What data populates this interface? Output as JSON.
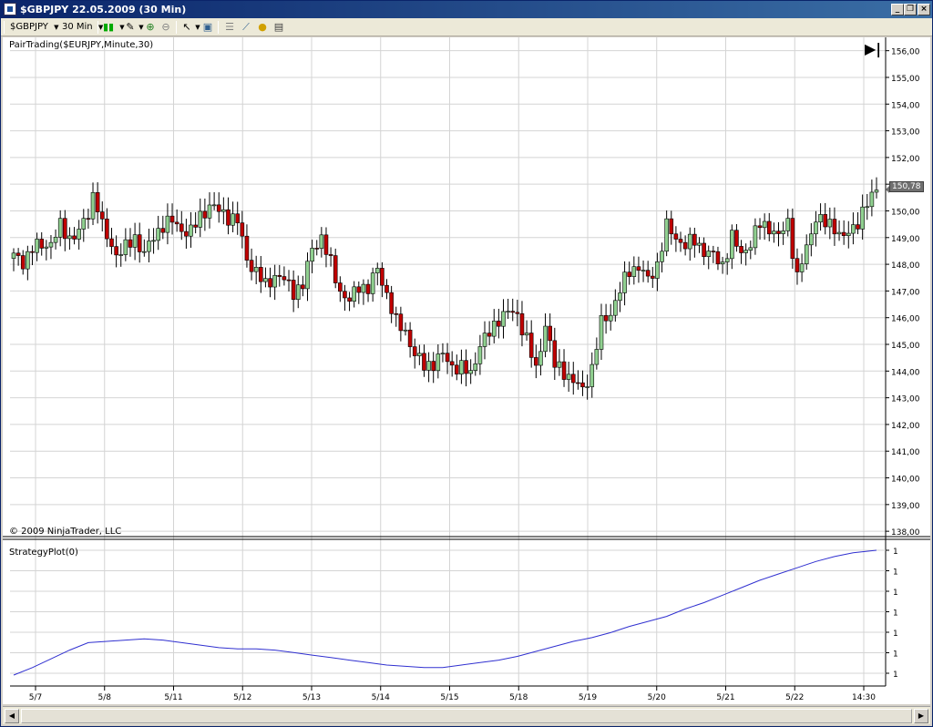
{
  "window": {
    "title": "$GBPJPY  22.05.2009 (30 Min)"
  },
  "toolbar": {
    "instrument": "$GBPJPY",
    "interval": "30 Min"
  },
  "chart": {
    "price_panel_label": "PairTrading($EURJPY,Minute,30)",
    "copyright": "© 2009 NinjaTrader, LLC",
    "strategy_panel_label": "StrategyPlot(0)",
    "last_price_label": "150,78",
    "colors": {
      "up": "#90d090",
      "down": "#c00000",
      "strategy_line": "#3030d0",
      "grid": "#d4d4d4"
    }
  },
  "chart_data": [
    {
      "type": "candlestick",
      "title": "PairTrading($EURJPY,Minute,30)",
      "ylim": [
        137.8,
        156.5
      ],
      "y_ticks": [
        "138,00",
        "139,00",
        "140,00",
        "141,00",
        "142,00",
        "143,00",
        "144,00",
        "145,00",
        "146,00",
        "147,00",
        "148,00",
        "149,00",
        "150,00",
        "151,00",
        "152,00",
        "153,00",
        "154,00",
        "155,00",
        "156,00"
      ],
      "x_ticks": [
        "5/7",
        "5/8",
        "5/11",
        "5/12",
        "5/13",
        "5/14",
        "5/15",
        "5/18",
        "5/19",
        "5/20",
        "5/21",
        "5/22",
        "14:30"
      ],
      "path": [
        [
          0,
          148.3
        ],
        [
          2,
          148.1
        ],
        [
          4,
          148.6
        ],
        [
          6,
          148.7
        ],
        [
          8,
          148.8
        ],
        [
          10,
          149.4
        ],
        [
          12,
          149.0
        ],
        [
          14,
          149.2
        ],
        [
          16,
          149.9
        ],
        [
          17,
          150.6
        ],
        [
          18,
          150.2
        ],
        [
          19,
          149.4
        ],
        [
          20,
          149.0
        ],
        [
          22,
          148.4
        ],
        [
          24,
          148.6
        ],
        [
          26,
          149.0
        ],
        [
          28,
          148.4
        ],
        [
          30,
          149.0
        ],
        [
          32,
          149.5
        ],
        [
          34,
          149.6
        ],
        [
          36,
          149.3
        ],
        [
          38,
          149.2
        ],
        [
          40,
          149.8
        ],
        [
          42,
          150.2
        ],
        [
          44,
          150.0
        ],
        [
          46,
          149.8
        ],
        [
          48,
          149.6
        ],
        [
          50,
          148.2
        ],
        [
          52,
          147.7
        ],
        [
          54,
          147.2
        ],
        [
          56,
          147.6
        ],
        [
          58,
          147.4
        ],
        [
          60,
          147.0
        ],
        [
          62,
          147.2
        ],
        [
          64,
          148.6
        ],
        [
          66,
          149.0
        ],
        [
          68,
          148.0
        ],
        [
          70,
          147.0
        ],
        [
          72,
          146.6
        ],
        [
          74,
          147.2
        ],
        [
          76,
          147.1
        ],
        [
          78,
          147.8
        ],
        [
          80,
          146.9
        ],
        [
          82,
          145.8
        ],
        [
          84,
          145.5
        ],
        [
          86,
          144.6
        ],
        [
          88,
          144.2
        ],
        [
          90,
          144.3
        ],
        [
          92,
          144.6
        ],
        [
          94,
          144.2
        ],
        [
          96,
          144.1
        ],
        [
          98,
          143.9
        ],
        [
          100,
          145.0
        ],
        [
          102,
          145.4
        ],
        [
          104,
          146.0
        ],
        [
          106,
          146.2
        ],
        [
          108,
          146.1
        ],
        [
          110,
          145.2
        ],
        [
          112,
          144.0
        ],
        [
          114,
          145.8
        ],
        [
          116,
          144.2
        ],
        [
          118,
          144.0
        ],
        [
          120,
          143.6
        ],
        [
          122,
          143.3
        ],
        [
          124,
          144.1
        ],
        [
          126,
          145.8
        ],
        [
          128,
          146.2
        ],
        [
          130,
          147.0
        ],
        [
          132,
          147.8
        ],
        [
          134,
          147.9
        ],
        [
          136,
          147.4
        ],
        [
          138,
          148.0
        ],
        [
          140,
          149.4
        ],
        [
          142,
          149.0
        ],
        [
          144,
          148.7
        ],
        [
          146,
          148.9
        ],
        [
          148,
          148.5
        ],
        [
          150,
          148.3
        ],
        [
          152,
          148.0
        ],
        [
          154,
          149.0
        ],
        [
          156,
          148.4
        ],
        [
          158,
          148.8
        ],
        [
          160,
          149.5
        ],
        [
          162,
          149.4
        ],
        [
          164,
          149.0
        ],
        [
          166,
          149.6
        ],
        [
          168,
          147.5
        ],
        [
          170,
          148.6
        ],
        [
          172,
          149.8
        ],
        [
          174,
          149.5
        ],
        [
          176,
          149.4
        ],
        [
          178,
          149.0
        ],
        [
          180,
          149.3
        ],
        [
          182,
          150.0
        ],
        [
          184,
          150.5
        ],
        [
          185,
          150.8
        ]
      ]
    },
    {
      "type": "line",
      "title": "StrategyPlot(0)",
      "y_tick_labels": [
        "1",
        "1",
        "1",
        "1",
        "1",
        "1",
        "1"
      ],
      "x": [
        0,
        4,
        8,
        12,
        16,
        20,
        24,
        28,
        32,
        36,
        40,
        44,
        48,
        52,
        56,
        60,
        64,
        68,
        72,
        76,
        80,
        84,
        88,
        92,
        96,
        100,
        104,
        108,
        112,
        116,
        120,
        124,
        128,
        132,
        136,
        140,
        144,
        148,
        152,
        156,
        160,
        164,
        168,
        172,
        176,
        180,
        185
      ],
      "values": [
        0.02,
        0.08,
        0.15,
        0.22,
        0.28,
        0.29,
        0.3,
        0.31,
        0.3,
        0.28,
        0.26,
        0.24,
        0.23,
        0.23,
        0.22,
        0.2,
        0.18,
        0.16,
        0.14,
        0.12,
        0.1,
        0.09,
        0.08,
        0.08,
        0.1,
        0.12,
        0.14,
        0.17,
        0.21,
        0.25,
        0.29,
        0.32,
        0.36,
        0.41,
        0.45,
        0.49,
        0.55,
        0.6,
        0.66,
        0.72,
        0.78,
        0.83,
        0.88,
        0.93,
        0.97,
        1.0,
        1.02
      ]
    }
  ]
}
